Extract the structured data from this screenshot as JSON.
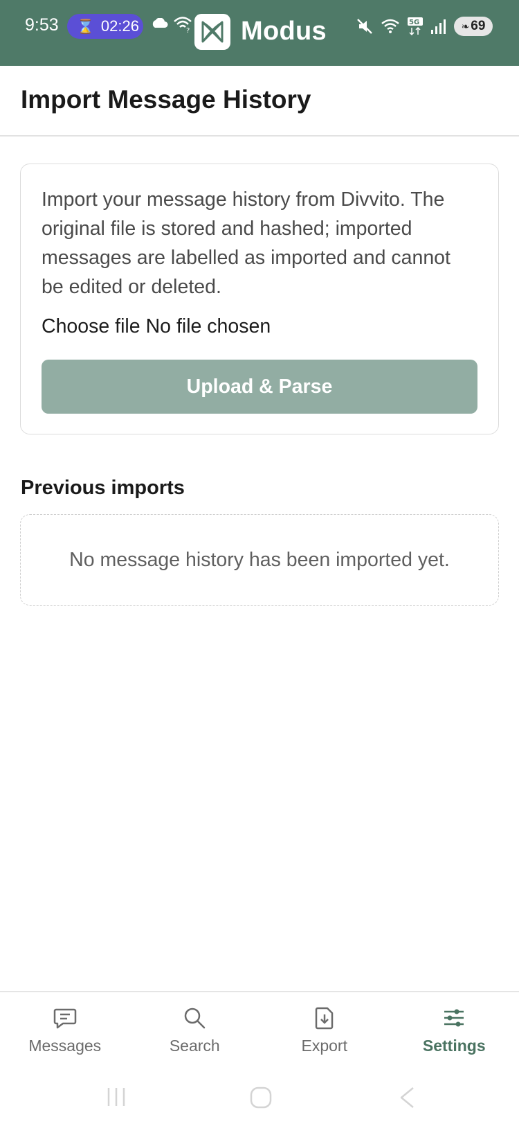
{
  "status_bar": {
    "time": "9:53",
    "timer": "02:26",
    "timer_icon": "hourglass-icon",
    "battery": "69"
  },
  "app": {
    "name": "Modus",
    "logo_icon": "modus-logo-icon",
    "bar_color": "#4f7a68"
  },
  "page": {
    "title": "Import Message History"
  },
  "import_card": {
    "description": "Import your message history from Divvito. The original file is stored and hashed; imported messages are labelled as imported and cannot be edited or deleted.",
    "choose_file_label": "Choose file",
    "file_status": "No file chosen",
    "upload_button": "Upload & Parse",
    "button_color": "#92ada3"
  },
  "previous_imports": {
    "title": "Previous imports",
    "empty_text": "No message history has been imported yet."
  },
  "bottom_nav": {
    "items": [
      {
        "label": "Messages",
        "icon": "message-icon",
        "active": false
      },
      {
        "label": "Search",
        "icon": "search-icon",
        "active": false
      },
      {
        "label": "Export",
        "icon": "export-file-icon",
        "active": false
      },
      {
        "label": "Settings",
        "icon": "sliders-icon",
        "active": true
      }
    ],
    "active_color": "#4a7361"
  }
}
